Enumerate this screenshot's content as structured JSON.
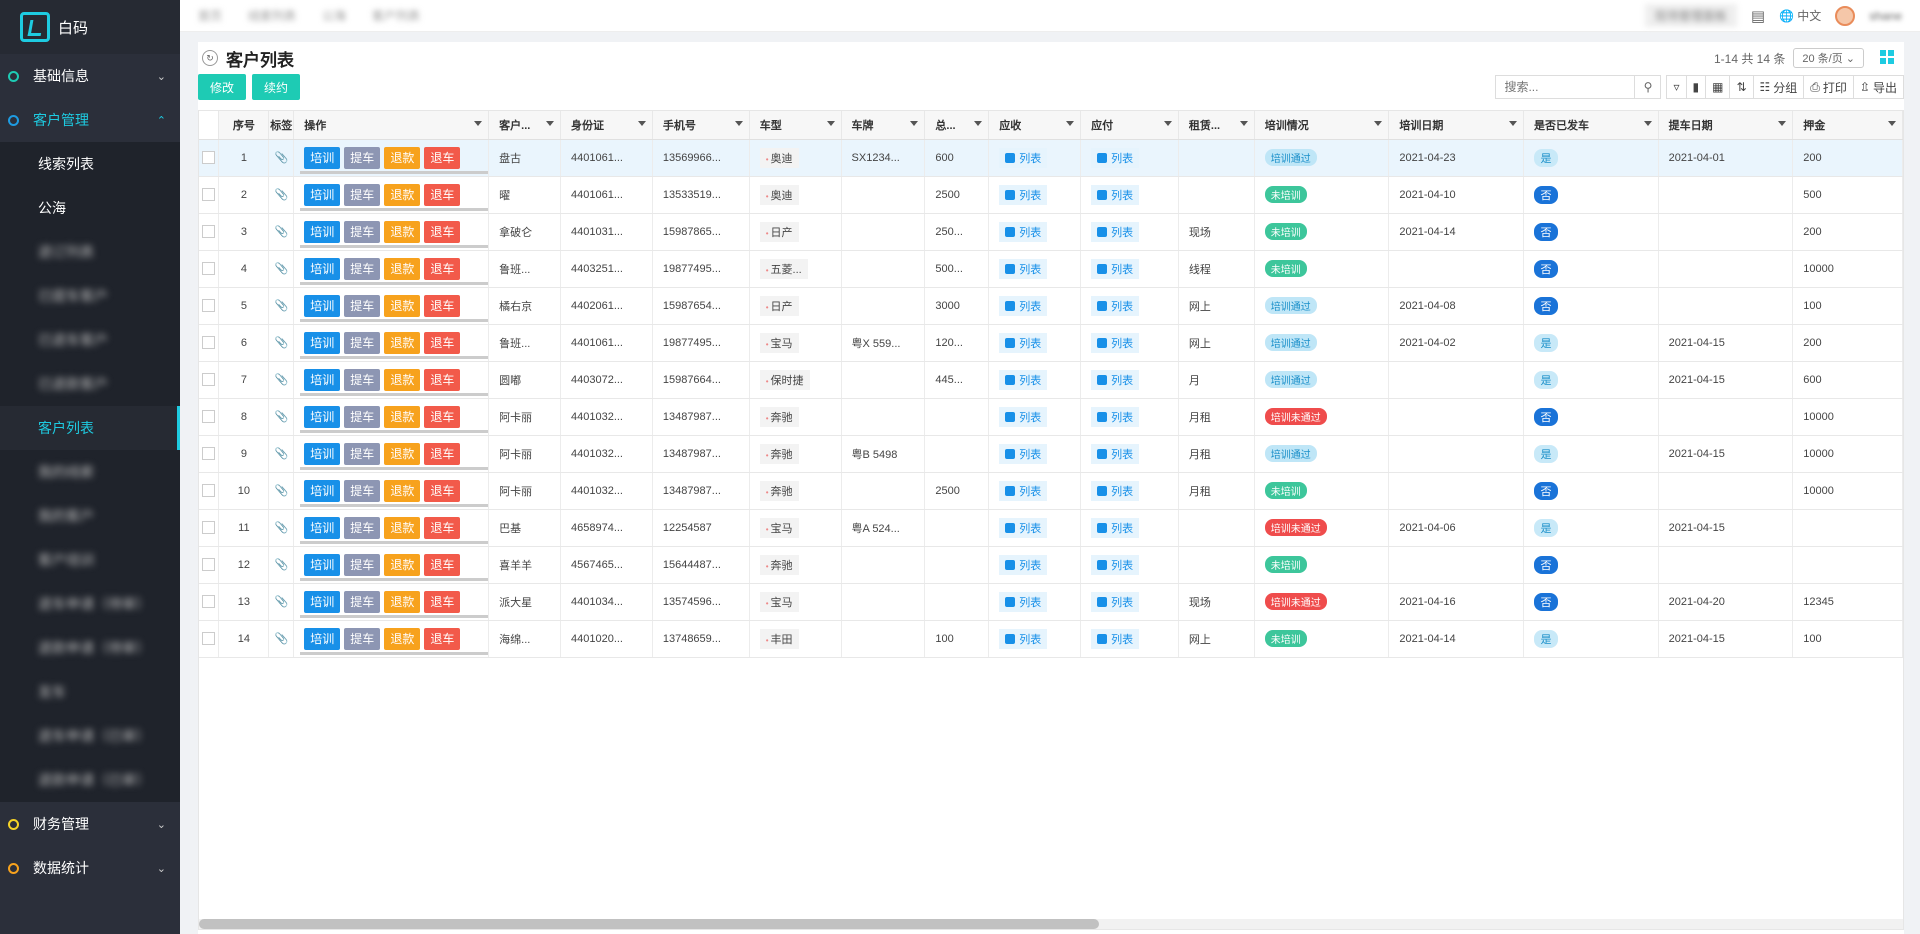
{
  "app": {
    "name": "白码"
  },
  "sidebar": {
    "groups": [
      {
        "label": "基础信息",
        "color": "#1ecbb4",
        "expanded": false
      },
      {
        "label": "客户管理",
        "color": "#1e9be1",
        "expanded": true
      },
      {
        "label": "财务管理",
        "color": "#f5d327",
        "expanded": false
      },
      {
        "label": "数据统计",
        "color": "#f7a21d",
        "expanded": false
      }
    ],
    "customer_items": [
      {
        "label": "线索列表",
        "blurred": false,
        "selected": false
      },
      {
        "label": "公海",
        "blurred": false,
        "selected": false
      },
      {
        "label": "退订列表",
        "blurred": true,
        "selected": false
      },
      {
        "label": "已提车客户",
        "blurred": true,
        "selected": false
      },
      {
        "label": "已退车客户",
        "blurred": true,
        "selected": false
      },
      {
        "label": "已退款客户",
        "blurred": true,
        "selected": false
      },
      {
        "label": "客户列表",
        "blurred": false,
        "selected": true
      },
      {
        "label": "我的线索",
        "blurred": true,
        "selected": false
      },
      {
        "label": "我的客户",
        "blurred": true,
        "selected": false
      },
      {
        "label": "客户培训",
        "blurred": true,
        "selected": false
      },
      {
        "label": "退车申请（待审）",
        "blurred": true,
        "selected": false
      },
      {
        "label": "退款申请（待审）",
        "blurred": true,
        "selected": false
      },
      {
        "label": "发车",
        "blurred": true,
        "selected": false
      },
      {
        "label": "退车申请（已审）",
        "blurred": true,
        "selected": false
      },
      {
        "label": "退款申请（已审）",
        "blurred": true,
        "selected": false
      }
    ]
  },
  "topbar": {
    "tabs": [
      "首页",
      "线索列表",
      "公海",
      "客户列表"
    ],
    "badge": "现场管理面板",
    "language": "中文",
    "user": "shane"
  },
  "page": {
    "title": "客户列表",
    "pager_text": "1-14 共 14 条",
    "page_size": "20 条/页",
    "buttons": {
      "edit": "修改",
      "renew": "续约"
    },
    "search_placeholder": "搜索...",
    "tools": {
      "group": "分组",
      "print": "打印",
      "export": "导出"
    }
  },
  "table": {
    "columns": [
      "序号",
      "标签",
      "操作",
      "客户...",
      "身份证",
      "手机号",
      "车型",
      "车牌",
      "总...",
      "应收",
      "应付",
      "租赁...",
      "培训情况",
      "培训日期",
      "是否已发车",
      "提车日期",
      "押金"
    ],
    "op_labels": [
      "培训",
      "提车",
      "退款",
      "退车"
    ],
    "link_label": "列表",
    "rows": [
      {
        "no": "1",
        "name": "盘古",
        "id": "4401061...",
        "phone": "13569966...",
        "model": "奥迪",
        "plate": "SX1234...",
        "total": "600",
        "lease": "",
        "train": "培训通过",
        "train_type": "pass",
        "train_date": "2021-04-23",
        "sent": "是",
        "pick_date": "2021-04-01",
        "deposit": "200"
      },
      {
        "no": "2",
        "name": "曜",
        "id": "4401061...",
        "phone": "13533519...",
        "model": "奥迪",
        "plate": "",
        "total": "2500",
        "lease": "",
        "train": "未培训",
        "train_type": "none",
        "train_date": "2021-04-10",
        "sent": "否",
        "pick_date": "",
        "deposit": "500"
      },
      {
        "no": "3",
        "name": "拿破仑",
        "id": "4401031...",
        "phone": "15987865...",
        "model": "日产",
        "plate": "",
        "total": "250...",
        "lease": "现场",
        "train": "未培训",
        "train_type": "none",
        "train_date": "2021-04-14",
        "sent": "否",
        "pick_date": "",
        "deposit": "200"
      },
      {
        "no": "4",
        "name": "鲁班...",
        "id": "4403251...",
        "phone": "19877495...",
        "model": "五菱...",
        "plate": "",
        "total": "500...",
        "lease": "线程",
        "train": "未培训",
        "train_type": "none",
        "train_date": "",
        "sent": "否",
        "pick_date": "",
        "deposit": "10000"
      },
      {
        "no": "5",
        "name": "橘右京",
        "id": "4402061...",
        "phone": "15987654...",
        "model": "日产",
        "plate": "",
        "total": "3000",
        "lease": "网上",
        "train": "培训通过",
        "train_type": "pass",
        "train_date": "2021-04-08",
        "sent": "否",
        "pick_date": "",
        "deposit": "100"
      },
      {
        "no": "6",
        "name": "鲁班...",
        "id": "4401061...",
        "phone": "19877495...",
        "model": "宝马",
        "plate": "粤X 559...",
        "total": "120...",
        "lease": "网上",
        "train": "培训通过",
        "train_type": "pass",
        "train_date": "2021-04-02",
        "sent": "是",
        "pick_date": "2021-04-15",
        "deposit": "200"
      },
      {
        "no": "7",
        "name": "圆嘟",
        "id": "4403072...",
        "phone": "15987664...",
        "model": "保时捷",
        "plate": "",
        "total": "445...",
        "lease": "月",
        "train": "培训通过",
        "train_type": "pass",
        "train_date": "",
        "sent": "是",
        "pick_date": "2021-04-15",
        "deposit": "600"
      },
      {
        "no": "8",
        "name": "阿卡丽",
        "id": "4401032...",
        "phone": "13487987...",
        "model": "奔驰",
        "plate": "",
        "total": "",
        "lease": "月租",
        "train": "培训未通过",
        "train_type": "fail",
        "train_date": "",
        "sent": "否",
        "pick_date": "",
        "deposit": "10000"
      },
      {
        "no": "9",
        "name": "阿卡丽",
        "id": "4401032...",
        "phone": "13487987...",
        "model": "奔驰",
        "plate": "粤B 5498",
        "total": "",
        "lease": "月租",
        "train": "培训通过",
        "train_type": "pass",
        "train_date": "",
        "sent": "是",
        "pick_date": "2021-04-15",
        "deposit": "10000"
      },
      {
        "no": "10",
        "name": "阿卡丽",
        "id": "4401032...",
        "phone": "13487987...",
        "model": "奔驰",
        "plate": "",
        "total": "2500",
        "lease": "月租",
        "train": "未培训",
        "train_type": "none",
        "train_date": "",
        "sent": "否",
        "pick_date": "",
        "deposit": "10000"
      },
      {
        "no": "11",
        "name": "巴基",
        "id": "4658974...",
        "phone": "12254587",
        "model": "宝马",
        "plate": "粤A 524...",
        "total": "",
        "lease": "",
        "train": "培训未通过",
        "train_type": "fail",
        "train_date": "2021-04-06",
        "sent": "是",
        "pick_date": "2021-04-15",
        "deposit": ""
      },
      {
        "no": "12",
        "name": "喜羊羊",
        "id": "4567465...",
        "phone": "15644487...",
        "model": "奔驰",
        "plate": "",
        "total": "",
        "lease": "",
        "train": "未培训",
        "train_type": "none",
        "train_date": "",
        "sent": "否",
        "pick_date": "",
        "deposit": ""
      },
      {
        "no": "13",
        "name": "派大星",
        "id": "4401034...",
        "phone": "13574596...",
        "model": "宝马",
        "plate": "",
        "total": "",
        "lease": "现场",
        "train": "培训未通过",
        "train_type": "fail",
        "train_date": "2021-04-16",
        "sent": "否",
        "pick_date": "2021-04-20",
        "deposit": "12345"
      },
      {
        "no": "14",
        "name": "海绵...",
        "id": "4401020...",
        "phone": "13748659...",
        "model": "丰田",
        "plate": "",
        "total": "100",
        "lease": "网上",
        "train": "未培训",
        "train_type": "none",
        "train_date": "2021-04-14",
        "sent": "是",
        "pick_date": "2021-04-15",
        "deposit": "100"
      }
    ]
  }
}
